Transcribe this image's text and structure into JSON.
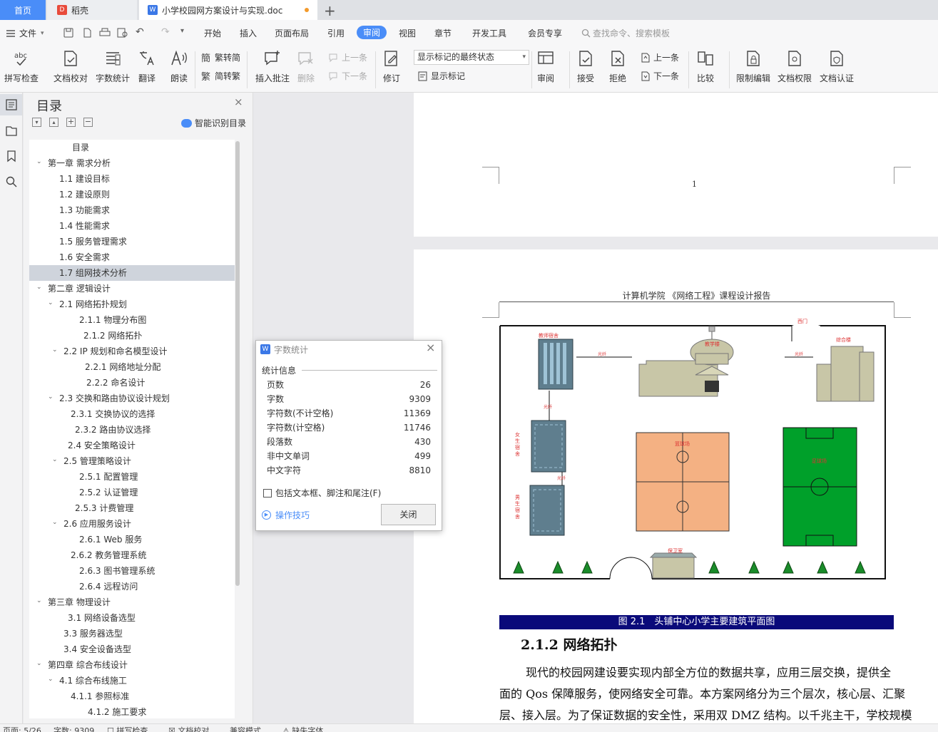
{
  "tabs": {
    "home": "首页",
    "daoke": "稻壳",
    "doc": "小学校园网方案设计与实现.doc"
  },
  "menu": {
    "file": "文件",
    "items": [
      "开始",
      "插入",
      "页面布局",
      "引用",
      "审阅",
      "视图",
      "章节",
      "开发工具",
      "会员专享"
    ],
    "search": "查找命令、搜索模板"
  },
  "ribbon": {
    "spell": "拼写检查",
    "proof": "文档校对",
    "wordcount": "字数统计",
    "translate": "翻译",
    "read": "朗读",
    "to_trad": "繁转简",
    "to_simp": "简转繁",
    "insert_comment": "插入批注",
    "delete": "删除",
    "prev": "上一条",
    "next": "下一条",
    "revise": "修订",
    "markup_state": "显示标记的最终状态",
    "show_markup": "显示标记",
    "review": "审阅",
    "accept": "接受",
    "reject": "拒绝",
    "prev2": "上一条",
    "next2": "下一条",
    "compare": "比较",
    "restrict": "限制编辑",
    "doc_perm": "文档权限",
    "doc_cert": "文档认证"
  },
  "toc": {
    "title": "目录",
    "smart": "智能识别目录",
    "items": [
      "目录",
      "第一章 需求分析",
      "1.1 建设目标",
      "1.2 建设原则",
      "1.3 功能需求",
      "1.4 性能需求",
      "1.5 服务管理需求",
      "1.6 安全需求",
      "1.7 组网技术分析",
      "第二章 逻辑设计",
      "2.1 网络拓扑规划",
      "2.1.1 物理分布图",
      "2.1.2 网络拓扑",
      "2.2 IP 规划和命名模型设计",
      "2.2.1 网络地址分配",
      "2.2.2 命名设计",
      "2.3 交换和路由协议设计规划",
      "2.3.1 交换协议的选择",
      "2.3.2 路由协议选择",
      "2.4 安全策略设计",
      "2.5 管理策略设计",
      "2.5.1 配置管理",
      "2.5.2 认证管理",
      "2.5.3 计费管理",
      "2.6 应用服务设计",
      "2.6.1 Web 服务",
      "2.6.2 教务管理系统",
      "2.6.3 图书管理系统",
      "2.6.4 远程访问",
      "第三章 物理设计",
      "3.1 网络设备选型",
      "3.3 服务器选型",
      "3.4 安全设备选型",
      "第四章 综合布线设计",
      "4.1 综合布线施工",
      "4.1.1 参照标准",
      "4.1.2 施工要求"
    ]
  },
  "document": {
    "page_number": "1",
    "header": "计算机学院 《网络工程》课程设计报告",
    "figure_labels": {
      "teacher_dorm": "教师宿舍",
      "teaching": "教学楼",
      "complex": "综合楼",
      "gate": "西门",
      "student_dorm_1": "女生宿舍",
      "student_dorm_2": "男生宿舍",
      "basketball": "篮球场",
      "football": "足球场",
      "guard": "保卫室",
      "link_1": "光纤",
      "link_2": "光纤",
      "link_3": "光纤",
      "link_4": "光纤"
    },
    "caption": "图 2.1　头铺中心小学主要建筑平面图",
    "heading": "2.1.2 网络拓扑",
    "para_lines": [
      "现代的校园网建设要实现内部全方位的数据共享，应用三层交换，提供全",
      "面的 Qos 保障服务，使网络安全可靠。本方案网络分为三个层次，核心层、汇聚",
      "层、接入层。为了保证数据的安全性，采用双 DMZ 结构。以千兆主干，学校规模"
    ]
  },
  "dialog": {
    "title": "字数统计",
    "section": "统计信息",
    "rows": [
      {
        "label": "页数",
        "value": "26"
      },
      {
        "label": "字数",
        "value": "9309"
      },
      {
        "label": "字符数(不计空格)",
        "value": "11369"
      },
      {
        "label": "字符数(计空格)",
        "value": "11746"
      },
      {
        "label": "段落数",
        "value": "430"
      },
      {
        "label": "非中文单词",
        "value": "499"
      },
      {
        "label": "中文字符",
        "value": "8810"
      }
    ],
    "checkbox": "包括文本框、脚注和尾注(F)",
    "tips": "操作技巧",
    "close": "关闭"
  },
  "status": {
    "page": "页面: 5/26",
    "words": "字数: 9309",
    "spell": "拼写检查",
    "proof": "文档校对",
    "compat": "兼容模式",
    "missing_font": "缺失字体"
  },
  "colors": {
    "accent": "#4a8df8",
    "caption_bg": "#0a0a7a",
    "basketball": "#f4b183",
    "football": "#00a02a"
  }
}
